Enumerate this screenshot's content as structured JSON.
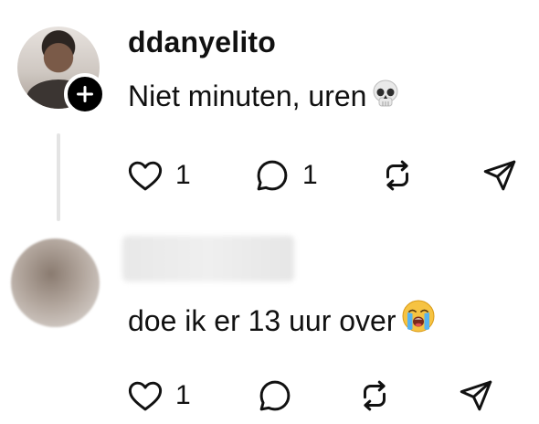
{
  "posts": [
    {
      "username": "ddanyelito",
      "text": "Niet minuten, uren",
      "text_emoji": "skull",
      "actions": {
        "like_count": "1",
        "comment_count": "1",
        "repost_count": "",
        "share_count": ""
      },
      "follow_badge": "plus-icon"
    },
    {
      "username": "",
      "text": "doe ik er 13 uur over",
      "text_emoji": "loudly-crying-face",
      "actions": {
        "like_count": "1",
        "comment_count": "",
        "repost_count": "",
        "share_count": ""
      }
    }
  ],
  "colors": {
    "text": "#111111",
    "thread_line": "#e4e4e4",
    "badge": "#000000"
  }
}
